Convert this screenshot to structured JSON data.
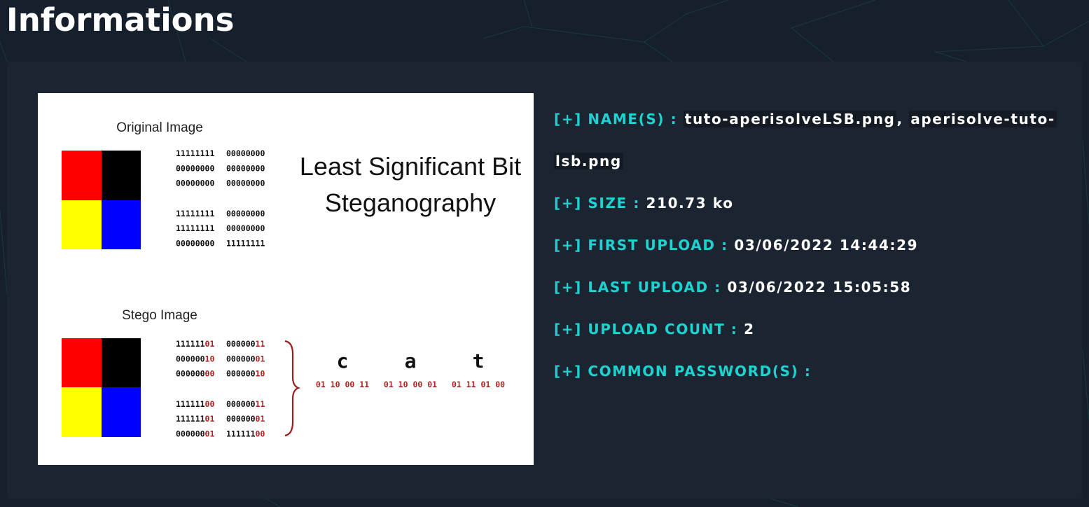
{
  "page": {
    "title": "Informations"
  },
  "preview": {
    "original_title": "Original Image",
    "stego_title": "Stego Image",
    "heading_line1": "Least Significant Bit",
    "heading_line2": "Steganography",
    "colors": {
      "red": "#ff0000",
      "black": "#000000",
      "yellow": "#ffff00",
      "blue": "#0000ff",
      "bit_highlight": "#b22222"
    },
    "original_bits": [
      [
        "11111111",
        "00000000"
      ],
      [
        "00000000",
        "00000000"
      ],
      [
        "00000000",
        "00000000"
      ],
      [
        "11111111",
        "00000000"
      ],
      [
        "11111111",
        "00000000"
      ],
      [
        "00000000",
        "11111111"
      ]
    ],
    "stego_bits": [
      [
        [
          "111111",
          "01"
        ],
        [
          "000000",
          "11"
        ]
      ],
      [
        [
          "000000",
          "10"
        ],
        [
          "000000",
          "01"
        ]
      ],
      [
        [
          "000000",
          "00"
        ],
        [
          "000000",
          "10"
        ]
      ],
      [
        [
          "111111",
          "00"
        ],
        [
          "000000",
          "11"
        ]
      ],
      [
        [
          "111111",
          "01"
        ],
        [
          "000000",
          "01"
        ]
      ],
      [
        [
          "000000",
          "01"
        ],
        [
          "111111",
          "00"
        ]
      ]
    ],
    "letters": [
      {
        "char": "c",
        "bits": "01 10 00 11"
      },
      {
        "char": "a",
        "bits": "01 10 00 01"
      },
      {
        "char": "t",
        "bits": "01 11 01 00"
      }
    ]
  },
  "info": {
    "names_label": "[+] NAME(S) : ",
    "name_1": "tuto-aperisolveLSB.png",
    "name_separator": ", ",
    "name_2_part1": "aperisolve-tuto-",
    "name_2_part2": "lsb.png",
    "size_label": "[+] SIZE : ",
    "size_value": "210.73 ko",
    "first_upload_label": "[+] FIRST UPLOAD : ",
    "first_upload_value": "03/06/2022 14:44:29",
    "last_upload_label": "[+] LAST UPLOAD : ",
    "last_upload_value": "03/06/2022 15:05:58",
    "upload_count_label": "[+] UPLOAD COUNT : ",
    "upload_count_value": "2",
    "common_passwords_label": "[+] COMMON PASSWORD(S) : ",
    "common_passwords_value": ""
  },
  "theme": {
    "background": "#16202c",
    "panel": "#1b2431",
    "label_color": "#1ed2d2",
    "value_color": "#ffffff"
  }
}
